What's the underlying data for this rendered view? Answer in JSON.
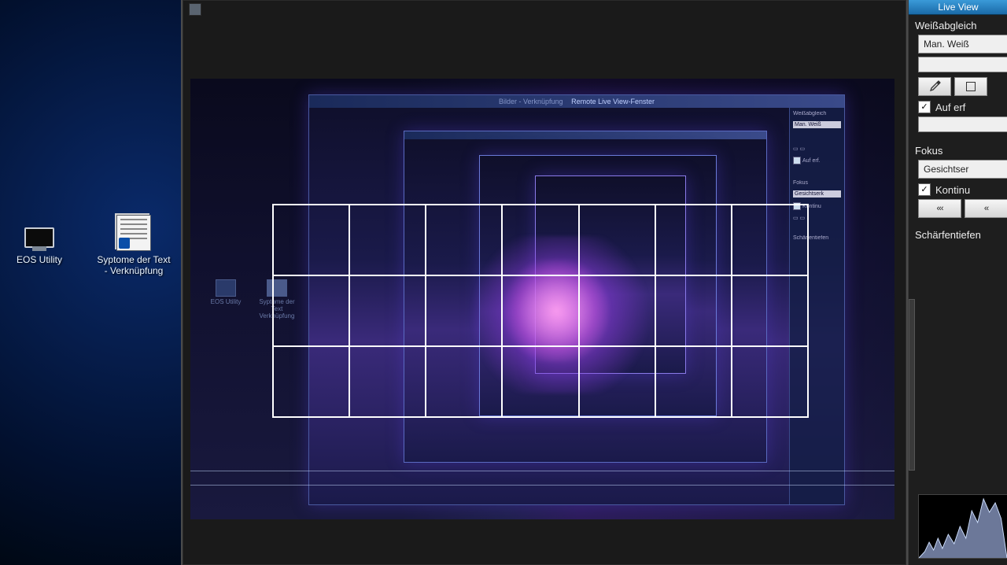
{
  "desktop": {
    "icons": [
      {
        "label": "EOS Utility"
      },
      {
        "label": "Syptome der Text\n- Verknüpfung"
      }
    ]
  },
  "liveview": {
    "inner_title_prefix": "Bilder - Verknüpfung",
    "inner_title": "Remote Live View-Fenster",
    "inner_panel": {
      "wb": "Weißabgleich",
      "wb_val": "Man. Weiß",
      "auf": "Auf erf.",
      "fokus": "Fokus",
      "gesicht": "Gesichtserk",
      "kontinu": "Kontinu",
      "schaerf": "Schärfentiefen"
    },
    "mini_icons": [
      {
        "label": "EOS Utility"
      },
      {
        "label": "Syptome der Text\nVerknüpfung"
      }
    ]
  },
  "panel": {
    "tab": "Live View",
    "wb_label": "Weißabgleich",
    "wb_value": "Man. Weiß",
    "auf_erf": "Auf erf",
    "fokus_label": "Fokus",
    "gesicht": "Gesichtser",
    "kontinu": "Kontinu",
    "nav_back": "‹‹‹",
    "nav_back2": "‹‹",
    "schaerf": "Schärfentiefen"
  }
}
